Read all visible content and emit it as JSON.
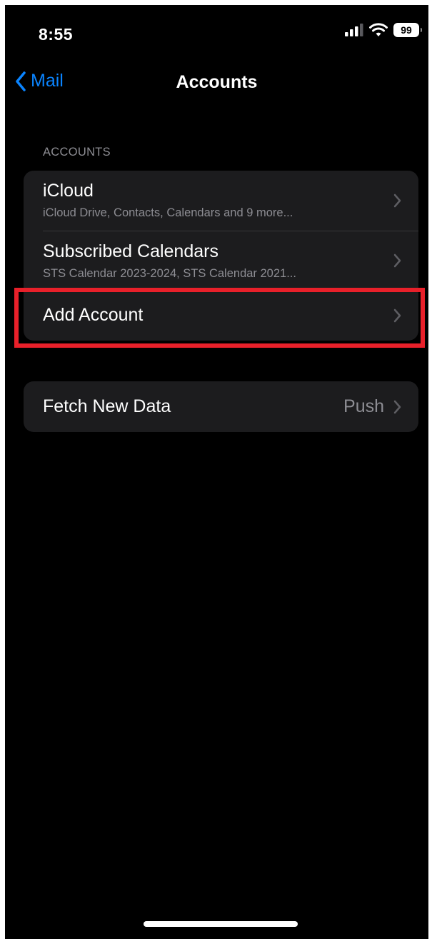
{
  "status_bar": {
    "time": "8:55",
    "battery": "99",
    "icons": [
      "cellular-signal-icon",
      "wifi-icon",
      "battery-icon"
    ]
  },
  "nav": {
    "back_label": "Mail",
    "title": "Accounts",
    "back_icon": "chevron-left-icon"
  },
  "accounts_section": {
    "header": "ACCOUNTS",
    "rows": [
      {
        "title": "iCloud",
        "subtitle": "iCloud Drive, Contacts, Calendars and 9 more..."
      },
      {
        "title": "Subscribed Calendars",
        "subtitle": "STS Calendar 2023-2024, STS Calendar 2021..."
      },
      {
        "title": "Add Account"
      }
    ]
  },
  "fetch_section": {
    "title": "Fetch New Data",
    "value": "Push"
  },
  "colors": {
    "background": "#000000",
    "cell": "#1c1c1e",
    "accent": "#0a84ff",
    "secondary_text": "#8d8d93",
    "highlight": "#e8202a"
  }
}
